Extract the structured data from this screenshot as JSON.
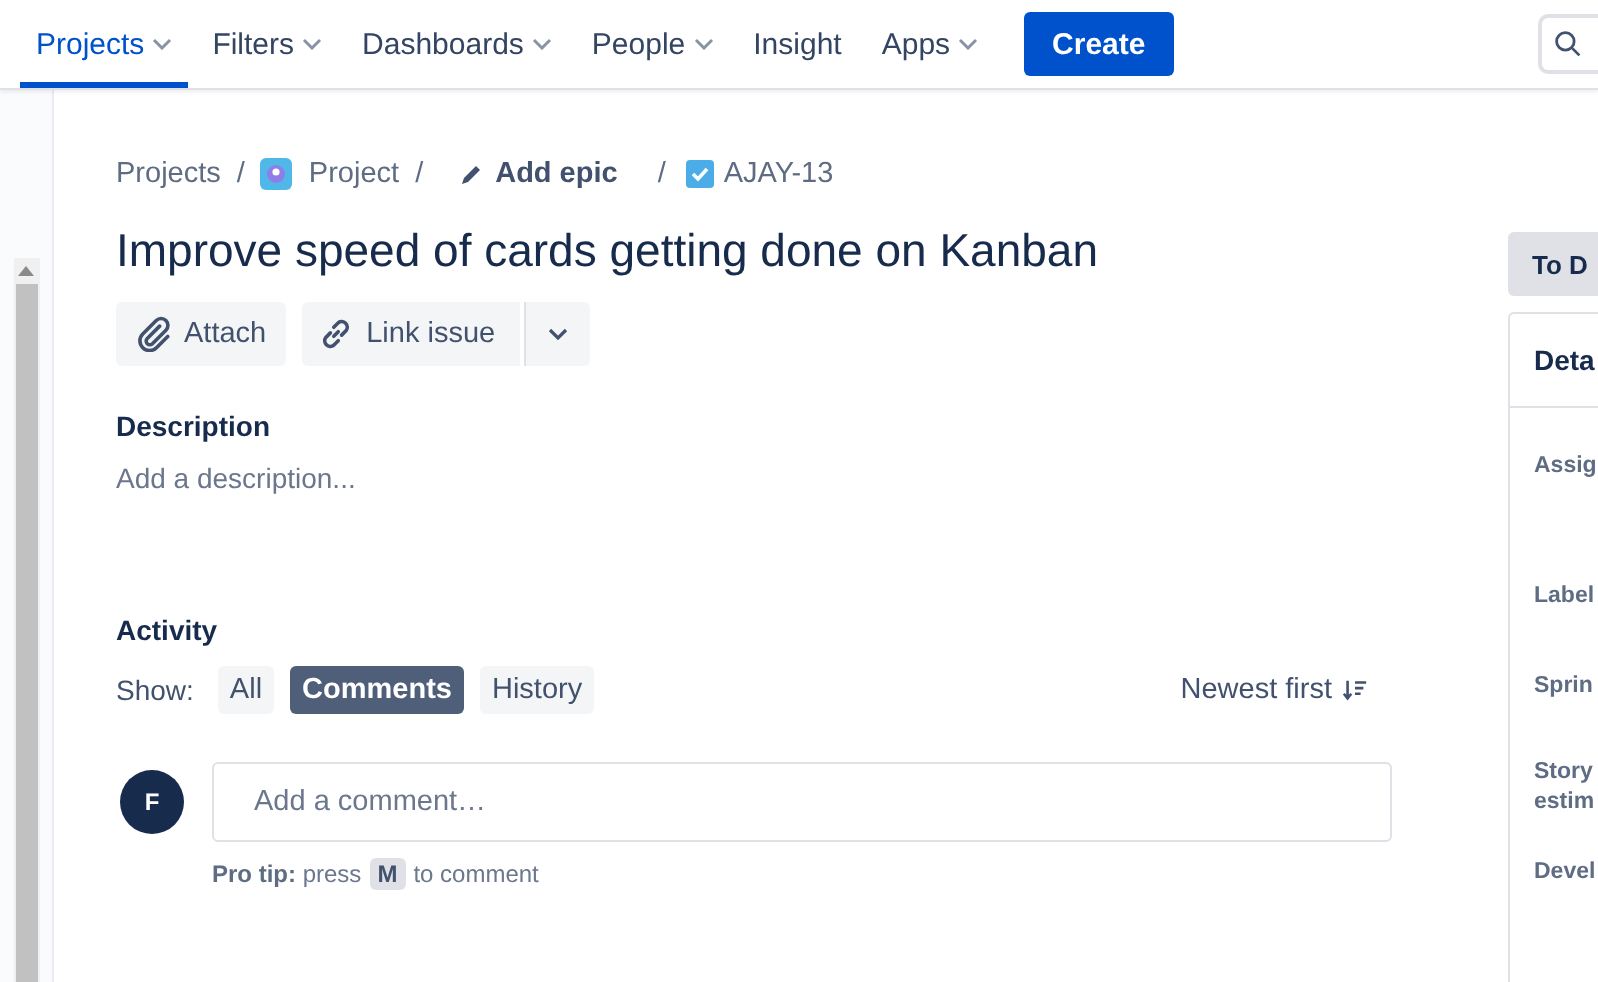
{
  "nav": {
    "items": [
      {
        "label": "Projects",
        "selected": true,
        "dropdown": true
      },
      {
        "label": "Filters",
        "selected": false,
        "dropdown": true
      },
      {
        "label": "Dashboards",
        "selected": false,
        "dropdown": true
      },
      {
        "label": "People",
        "selected": false,
        "dropdown": true
      },
      {
        "label": "Insight",
        "selected": false,
        "dropdown": false
      },
      {
        "label": "Apps",
        "selected": false,
        "dropdown": true
      }
    ],
    "create_button": "Create"
  },
  "breadcrumb": {
    "projects": "Projects",
    "project": "Project",
    "add_epic": "Add epic",
    "issue_key": "AJAY-13",
    "separators": [
      "/",
      "/",
      "/"
    ]
  },
  "issue": {
    "title": "Improve speed of cards getting done on Kanban",
    "attach": "Attach",
    "link_issue": "Link issue"
  },
  "description": {
    "heading": "Description",
    "placeholder": "Add a description..."
  },
  "activity": {
    "heading": "Activity",
    "show_label": "Show:",
    "filters": [
      {
        "label": "All",
        "selected": false
      },
      {
        "label": "Comments",
        "selected": true
      },
      {
        "label": "History",
        "selected": false
      }
    ],
    "sort": "Newest first",
    "avatar_initial": "F",
    "comment_placeholder": "Add a comment…",
    "pro_tip": "**Pro tip:** press",
    "pro_tip_key": "M",
    "pro_tip_end": "to comment"
  },
  "side_panel": {
    "status": "To D",
    "details_heading": "Deta",
    "fields": [
      {
        "label": "Assig"
      },
      {
        "label": "Label"
      },
      {
        "label": "Sprin"
      },
      {
        "label": "Story estim"
      },
      {
        "label": "Devel"
      }
    ]
  }
}
